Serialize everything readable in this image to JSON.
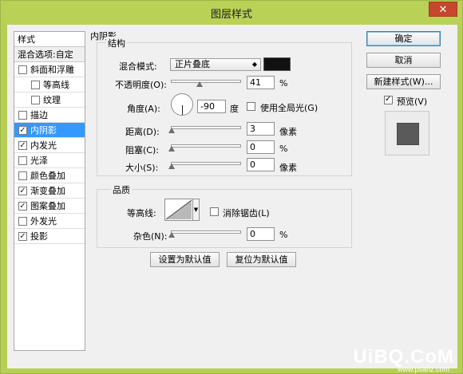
{
  "window": {
    "title": "图层样式",
    "close": "✕"
  },
  "styles": {
    "header": "样式",
    "blend_options": "混合选项:自定",
    "items": [
      {
        "label": "斜面和浮雕",
        "checked": false,
        "sub": false,
        "active": false
      },
      {
        "label": "等高线",
        "checked": false,
        "sub": true,
        "active": false
      },
      {
        "label": "纹理",
        "checked": false,
        "sub": true,
        "active": false
      },
      {
        "label": "描边",
        "checked": false,
        "sub": false,
        "active": false
      },
      {
        "label": "内阴影",
        "checked": true,
        "sub": false,
        "active": true
      },
      {
        "label": "内发光",
        "checked": true,
        "sub": false,
        "active": false
      },
      {
        "label": "光泽",
        "checked": false,
        "sub": false,
        "active": false
      },
      {
        "label": "颜色叠加",
        "checked": false,
        "sub": false,
        "active": false
      },
      {
        "label": "渐变叠加",
        "checked": true,
        "sub": false,
        "active": false
      },
      {
        "label": "图案叠加",
        "checked": true,
        "sub": false,
        "active": false
      },
      {
        "label": "外发光",
        "checked": false,
        "sub": false,
        "active": false
      },
      {
        "label": "投影",
        "checked": true,
        "sub": false,
        "active": false
      }
    ]
  },
  "inner_shadow": {
    "section_title": "内阴影",
    "structure": {
      "title": "结构",
      "blend_mode_label": "混合模式:",
      "blend_mode_value": "正片叠底",
      "shadow_color": "#111111",
      "opacity_label": "不透明度(O):",
      "opacity_value": "41",
      "opacity_unit": "%",
      "opacity_level": 0.41,
      "angle_label": "角度(A):",
      "angle_value": "-90",
      "angle_unit": "度",
      "global_light_label": "使用全局光(G)",
      "global_light_checked": false,
      "distance_label": "距离(D):",
      "distance_value": "3",
      "distance_unit": "像素",
      "choke_label": "阻塞(C):",
      "choke_value": "0",
      "choke_unit": "%",
      "size_label": "大小(S):",
      "size_value": "0",
      "size_unit": "像素"
    },
    "quality": {
      "title": "品质",
      "contour_label": "等高线:",
      "anti_alias_label": "消除锯齿(L)",
      "anti_alias_checked": false,
      "noise_label": "杂色(N):",
      "noise_value": "0",
      "noise_unit": "%"
    },
    "make_default": "设置为默认值",
    "reset_default": "复位为默认值"
  },
  "buttons": {
    "ok": "确定",
    "cancel": "取消",
    "new_style": "新建样式(W)...",
    "preview_label": "预览(V)",
    "preview_checked": true
  },
  "watermark": {
    "brand": "UiBQ.CoM",
    "url": "www.psahz.com"
  }
}
